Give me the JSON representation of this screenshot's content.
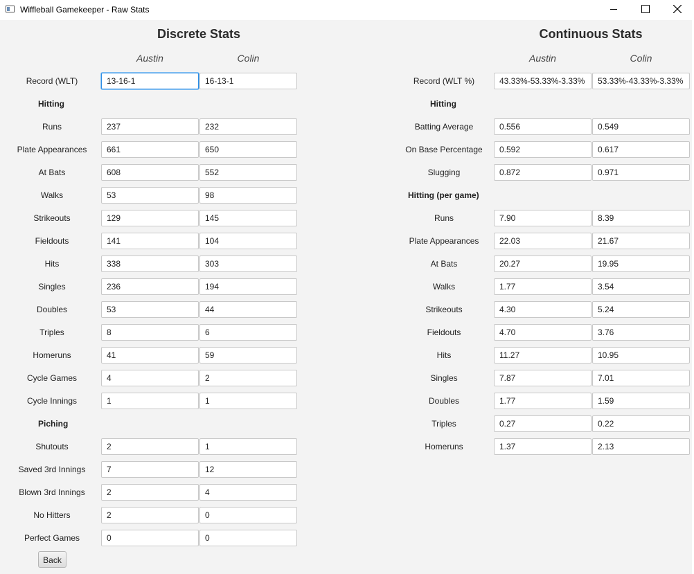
{
  "window": {
    "title": "Wiffleball Gamekeeper - Raw Stats"
  },
  "discrete": {
    "heading": "Discrete Stats",
    "players": [
      "Austin",
      "Colin"
    ],
    "record": {
      "label": "Record (WLT)",
      "values": [
        "13-16-1",
        "16-13-1"
      ]
    },
    "hitting": {
      "heading": "Hitting",
      "rows": [
        {
          "label": "Runs",
          "values": [
            "237",
            "232"
          ]
        },
        {
          "label": "Plate Appearances",
          "values": [
            "661",
            "650"
          ]
        },
        {
          "label": "At Bats",
          "values": [
            "608",
            "552"
          ]
        },
        {
          "label": "Walks",
          "values": [
            "53",
            "98"
          ]
        },
        {
          "label": "Strikeouts",
          "values": [
            "129",
            "145"
          ]
        },
        {
          "label": "Fieldouts",
          "values": [
            "141",
            "104"
          ]
        },
        {
          "label": "Hits",
          "values": [
            "338",
            "303"
          ]
        },
        {
          "label": "Singles",
          "values": [
            "236",
            "194"
          ]
        },
        {
          "label": "Doubles",
          "values": [
            "53",
            "44"
          ]
        },
        {
          "label": "Triples",
          "values": [
            "8",
            "6"
          ]
        },
        {
          "label": "Homeruns",
          "values": [
            "41",
            "59"
          ]
        },
        {
          "label": "Cycle Games",
          "values": [
            "4",
            "2"
          ]
        },
        {
          "label": "Cycle Innings",
          "values": [
            "1",
            "1"
          ]
        }
      ]
    },
    "pitching": {
      "heading": "Piching",
      "rows": [
        {
          "label": "Shutouts",
          "values": [
            "2",
            "1"
          ]
        },
        {
          "label": "Saved 3rd Innings",
          "values": [
            "7",
            "12"
          ]
        },
        {
          "label": "Blown 3rd Innings",
          "values": [
            "2",
            "4"
          ]
        },
        {
          "label": "No Hitters",
          "values": [
            "2",
            "0"
          ]
        },
        {
          "label": "Perfect Games",
          "values": [
            "0",
            "0"
          ]
        }
      ]
    }
  },
  "continuous": {
    "heading": "Continuous Stats",
    "players": [
      "Austin",
      "Colin"
    ],
    "record": {
      "label": "Record (WLT %)",
      "values": [
        "43.33%-53.33%-3.33%",
        "53.33%-43.33%-3.33%"
      ]
    },
    "hitting": {
      "heading": "Hitting",
      "rows": [
        {
          "label": "Batting Average",
          "values": [
            "0.556",
            "0.549"
          ]
        },
        {
          "label": "On Base Percentage",
          "values": [
            "0.592",
            "0.617"
          ]
        },
        {
          "label": "Slugging",
          "values": [
            "0.872",
            "0.971"
          ]
        }
      ]
    },
    "per_game": {
      "heading": "Hitting (per game)",
      "rows": [
        {
          "label": "Runs",
          "values": [
            "7.90",
            "8.39"
          ]
        },
        {
          "label": "Plate Appearances",
          "values": [
            "22.03",
            "21.67"
          ]
        },
        {
          "label": "At Bats",
          "values": [
            "20.27",
            "19.95"
          ]
        },
        {
          "label": "Walks",
          "values": [
            "1.77",
            "3.54"
          ]
        },
        {
          "label": "Strikeouts",
          "values": [
            "4.30",
            "5.24"
          ]
        },
        {
          "label": "Fieldouts",
          "values": [
            "4.70",
            "3.76"
          ]
        },
        {
          "label": "Hits",
          "values": [
            "11.27",
            "10.95"
          ]
        },
        {
          "label": "Singles",
          "values": [
            "7.87",
            "7.01"
          ]
        },
        {
          "label": "Doubles",
          "values": [
            "1.77",
            "1.59"
          ]
        },
        {
          "label": "Triples",
          "values": [
            "0.27",
            "0.22"
          ]
        },
        {
          "label": "Homeruns",
          "values": [
            "1.37",
            "2.13"
          ]
        }
      ]
    }
  },
  "back_button": "Back",
  "icons": {
    "app": "window-app-icon",
    "minimize": "minimize-icon",
    "maximize": "maximize-icon",
    "close": "close-icon"
  }
}
